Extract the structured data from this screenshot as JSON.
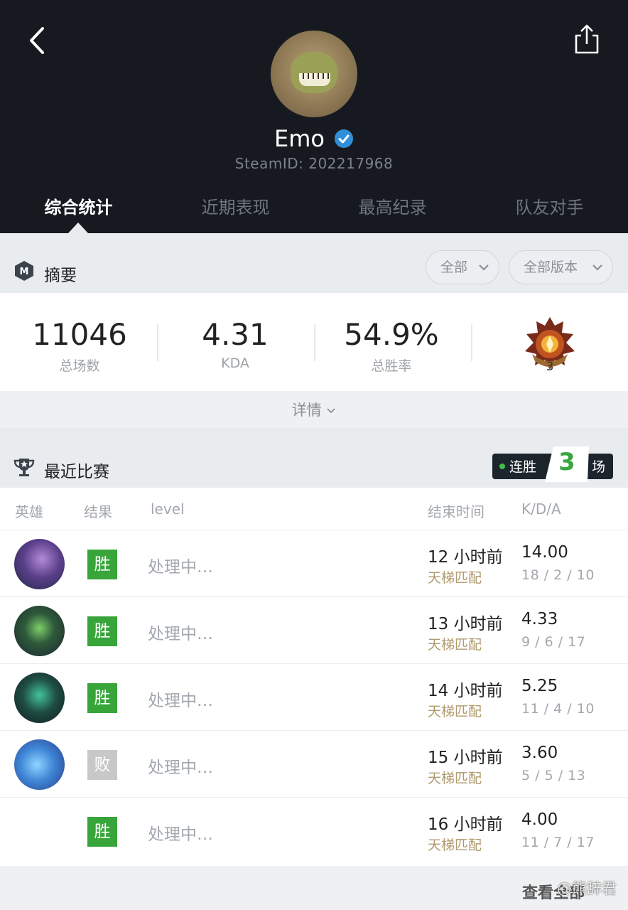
{
  "header": {
    "name": "Emo",
    "steam_id": "SteamID: 202217968",
    "tabs": [
      "综合统计",
      "近期表现",
      "最高纪录",
      "队友对手"
    ],
    "active_tab": 0,
    "verified_color": "#2f8fd8"
  },
  "summary": {
    "title": "摘要",
    "filter_all": "全部",
    "filter_version": "全部版本",
    "stats": [
      {
        "value": "11046",
        "label": "总场数"
      },
      {
        "value": "4.31",
        "label": "KDA"
      },
      {
        "value": "54.9%",
        "label": "总胜率"
      }
    ],
    "rank_medal_number": "3",
    "details_label": "详情"
  },
  "recent": {
    "title": "最近比赛",
    "streak_label": "连胜",
    "streak_count": "3",
    "streak_unit": "场",
    "columns": [
      "英雄",
      "结果",
      "level",
      "结束时间",
      "K/D/A"
    ],
    "matches": [
      {
        "hero": "hero-1",
        "result": "胜",
        "level": "处理中…",
        "time": "12 小时前",
        "mode": "天梯匹配",
        "kda": "14.00",
        "kda_raw": "18 / 2 / 10"
      },
      {
        "hero": "hero-2",
        "result": "胜",
        "level": "处理中…",
        "time": "13 小时前",
        "mode": "天梯匹配",
        "kda": "4.33",
        "kda_raw": "9 / 6 / 17"
      },
      {
        "hero": "hero-3",
        "result": "胜",
        "level": "处理中…",
        "time": "14 小时前",
        "mode": "天梯匹配",
        "kda": "5.25",
        "kda_raw": "11 / 4 / 10"
      },
      {
        "hero": "hero-4",
        "result": "败",
        "level": "处理中…",
        "time": "15 小时前",
        "mode": "天梯匹配",
        "kda": "3.60",
        "kda_raw": "5 / 5 / 13"
      },
      {
        "hero": "",
        "result": "胜",
        "level": "处理中…",
        "time": "16 小时前",
        "mode": "天梯匹配",
        "kda": "4.00",
        "kda_raw": "11 / 7 / 17"
      }
    ],
    "view_all": "查看全部",
    "watermark": "@熊辞君"
  }
}
